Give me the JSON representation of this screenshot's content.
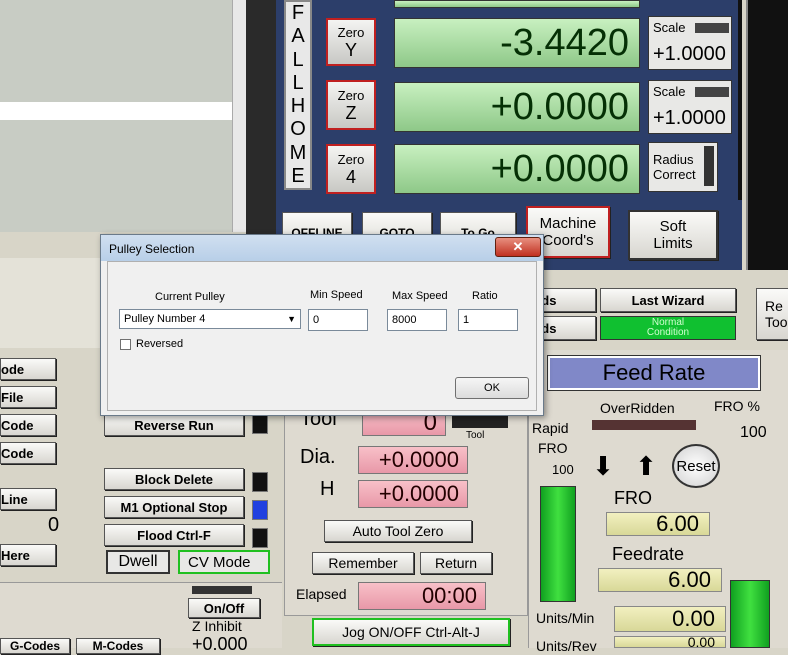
{
  "left_panel": {
    "buttons": [
      "ode",
      "File",
      "Code",
      "Code",
      "Line",
      "Here"
    ],
    "value_zero": "0",
    "line_value": "0"
  },
  "fall_home": "FALL HOME",
  "zero_buttons": [
    {
      "top": "Zero",
      "axis": "Y"
    },
    {
      "top": "Zero",
      "axis": "Z"
    },
    {
      "top": "Zero",
      "axis": "4"
    }
  ],
  "dro": [
    "-3.4420",
    "+0.0000",
    "+0.0000"
  ],
  "scale": [
    {
      "label": "Scale",
      "value": "+1.0000"
    },
    {
      "label": "Scale",
      "value": "+1.0000"
    }
  ],
  "radius_correct": [
    "Radius",
    "Correct"
  ],
  "nav_buttons": {
    "offline": "OFFLINE",
    "goto": "GOTO",
    "to_go": "To Go",
    "machine_coords": [
      "Machine",
      "Coord's"
    ],
    "soft_limits": [
      "Soft",
      "Limits"
    ]
  },
  "wizards": {
    "wizards1": "ards",
    "wizards2": "ards",
    "last_wizard": "Last Wizard",
    "normal_condition": [
      "Normal",
      "Condition"
    ],
    "regen_tool": [
      "Re",
      "Tool"
    ]
  },
  "middle": {
    "reverse_run": "Reverse Run",
    "block_delete": "Block Delete",
    "m1_optional_stop": "M1 Optional Stop",
    "flood": "Flood Ctrl-F",
    "dwell": "Dwell",
    "cv_mode": "CV Mode"
  },
  "tool": {
    "tool_label": "Tool",
    "tool_value": "0",
    "tool_small": "Tool",
    "dia_label": "Dia.",
    "dia_value": "+0.0000",
    "h_label": "H",
    "h_value": "+0.0000",
    "auto_tool_zero": "Auto Tool Zero",
    "remember": "Remember",
    "return": "Return",
    "elapsed_label": "Elapsed",
    "elapsed_value": "00:00",
    "jog": "Jog ON/OFF Ctrl-Alt-J"
  },
  "bottom_left": {
    "on_off": "On/Off",
    "z_inhibit": "Z Inhibit",
    "z_value": "+0.000",
    "g_codes": "G-Codes",
    "m_codes": "M-Codes"
  },
  "feed": {
    "title": "Feed Rate",
    "overridden": "OverRidden",
    "fro_pct_label": "FRO %",
    "fro_pct_value": "100",
    "rapid": "Rapid",
    "fro_small": "FRO",
    "rapid_value": "100",
    "reset": "Reset",
    "fro_label": "FRO",
    "fro_value": "6.00",
    "feedrate_label": "Feedrate",
    "feedrate_value": "6.00",
    "units_min_label": "Units/Min",
    "units_min_value": "0.00",
    "units_rev_label": "Units/Rev",
    "units_rev_value": "0.00"
  },
  "dialog": {
    "title": "Pulley Selection",
    "current_pulley_label": "Current Pulley",
    "min_speed_label": "Min Speed",
    "max_speed_label": "Max Speed",
    "ratio_label": "Ratio",
    "pulley_value": "Pulley Number 4",
    "min_speed_value": "0",
    "max_speed_value": "8000",
    "ratio_value": "1",
    "reversed_label": "Reversed",
    "ok": "OK"
  }
}
